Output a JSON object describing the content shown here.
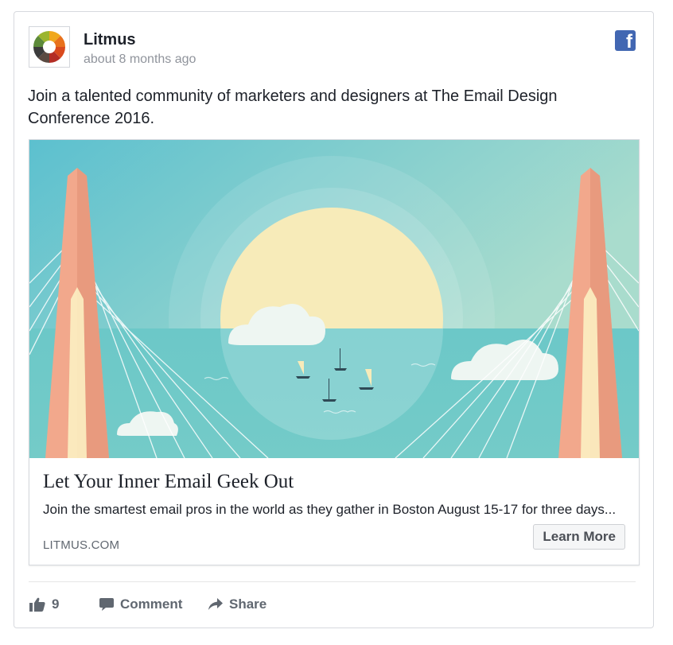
{
  "post": {
    "author": "Litmus",
    "timestamp": "about 8 months ago",
    "network_icon": "facebook-icon",
    "text": "Join a talented community of marketers and designers at The Email Design Conference 2016."
  },
  "link_preview": {
    "image": "illustration of a cable-stayed bridge over water at sunset with sailboats and clouds",
    "title": "Let Your Inner Email Geek Out",
    "description": "Join the smartest email pros in the world as they gather in Boston August 15-17 for three days...",
    "domain": "LITMUS.COM",
    "cta_label": "Learn More"
  },
  "actions": {
    "like_count": "9",
    "comment_label": "Comment",
    "share_label": "Share"
  },
  "colors": {
    "facebook_blue": "#4267b2",
    "sky": "#6fc6d0",
    "sun": "#f7ebb9",
    "sea": "#6ec9c9",
    "bridge": "#f2a88c"
  }
}
